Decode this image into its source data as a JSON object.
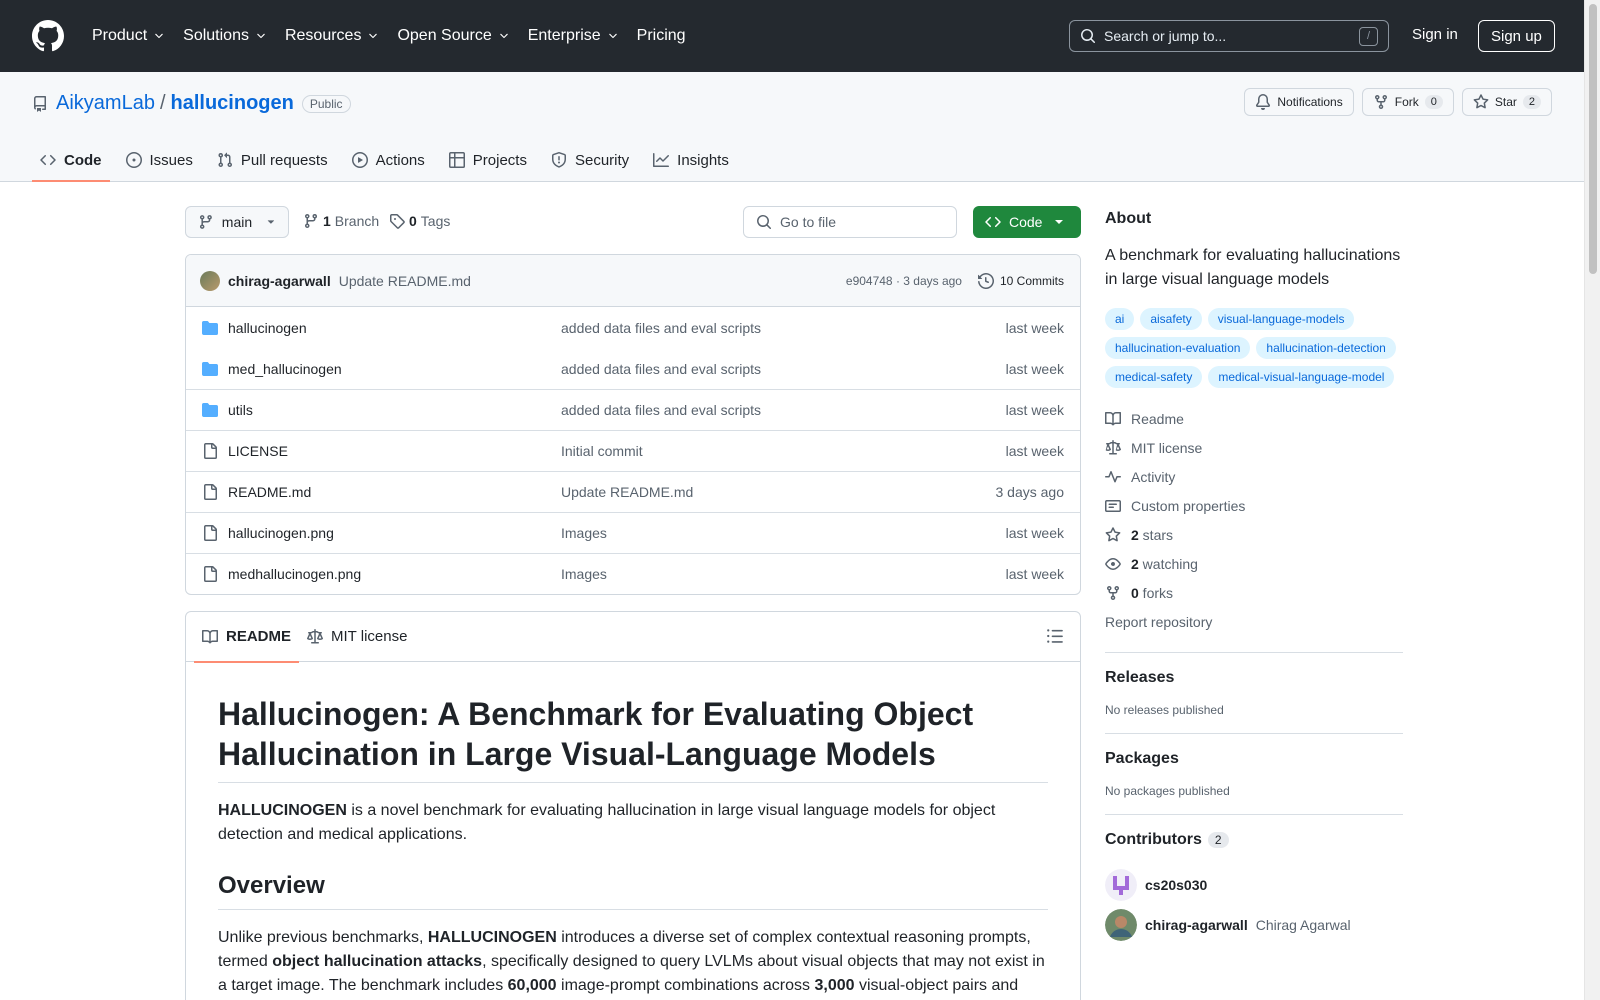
{
  "header": {
    "nav": [
      "Product",
      "Solutions",
      "Resources",
      "Open Source",
      "Enterprise",
      "Pricing"
    ],
    "search_placeholder": "Search or jump to...",
    "search_shortcut": "/",
    "signin": "Sign in",
    "signup": "Sign up"
  },
  "repo": {
    "owner": "AikyamLab",
    "separator": "/",
    "name": "hallucinogen",
    "visibility": "Public",
    "notifications": "Notifications",
    "fork_label": "Fork",
    "fork_count": "0",
    "star_label": "Star",
    "star_count": "2",
    "tabs": [
      "Code",
      "Issues",
      "Pull requests",
      "Actions",
      "Projects",
      "Security",
      "Insights"
    ]
  },
  "file_nav": {
    "branch": "main",
    "branch_count": "1",
    "branch_label": "Branch",
    "tag_count": "0",
    "tag_label": "Tags",
    "goto_placeholder": "Go to file",
    "code_button": "Code"
  },
  "latest_commit": {
    "author": "chirag-agarwall",
    "message": "Update README.md",
    "meta": "e904748 · 3 days ago",
    "commits": "10 Commits"
  },
  "files": [
    {
      "type": "dir",
      "name": "hallucinogen",
      "message": "added data files and eval scripts",
      "time": "last week"
    },
    {
      "type": "dir",
      "name": "med_hallucinogen",
      "message": "added data files and eval scripts",
      "time": "last week"
    },
    {
      "type": "dir",
      "name": "utils",
      "message": "added data files and eval scripts",
      "time": "last week"
    },
    {
      "type": "file",
      "name": "LICENSE",
      "message": "Initial commit",
      "time": "last week"
    },
    {
      "type": "file",
      "name": "README.md",
      "message": "Update README.md",
      "time": "3 days ago"
    },
    {
      "type": "file",
      "name": "hallucinogen.png",
      "message": "Images",
      "time": "last week"
    },
    {
      "type": "file",
      "name": "medhallucinogen.png",
      "message": "Images",
      "time": "last week"
    }
  ],
  "readme": {
    "tabs": [
      "README",
      "MIT license"
    ],
    "title": "Hallucinogen: A Benchmark for Evaluating Object Hallucination in Large Visual-Language Models",
    "intro_bold": "HALLUCINOGEN",
    "intro_rest": " is a novel benchmark for evaluating hallucination in large visual language models for object detection and medical applications.",
    "overview_heading": "Overview",
    "overview_parts": [
      {
        "t": "Unlike previous benchmarks, ",
        "b": false
      },
      {
        "t": "HALLUCINOGEN",
        "b": true
      },
      {
        "t": " introduces a diverse set of complex contextual reasoning prompts, termed ",
        "b": false
      },
      {
        "t": "object hallucination attacks",
        "b": true
      },
      {
        "t": ", specifically designed to query LVLMs about visual objects that may not exist in a target image. The benchmark includes ",
        "b": false
      },
      {
        "t": "60,000",
        "b": true
      },
      {
        "t": " image-prompt combinations across ",
        "b": false
      },
      {
        "t": "3,000",
        "b": true
      },
      {
        "t": " visual-object pairs and",
        "b": false
      }
    ]
  },
  "about": {
    "heading": "About",
    "description": "A benchmark for evaluating hallucinations in large visual language models",
    "topics": [
      "ai",
      "aisafety",
      "visual-language-models",
      "hallucination-evaluation",
      "hallucination-detection",
      "medical-safety",
      "medical-visual-language-model"
    ],
    "links": [
      {
        "icon": "book-icon",
        "bold": "",
        "text": "Readme"
      },
      {
        "icon": "law-icon",
        "bold": "",
        "text": "MIT license"
      },
      {
        "icon": "pulse-icon",
        "bold": "",
        "text": "Activity"
      },
      {
        "icon": "note-icon",
        "bold": "",
        "text": "Custom properties"
      },
      {
        "icon": "star-icon",
        "bold": "2",
        "text": " stars"
      },
      {
        "icon": "eye-icon",
        "bold": "2",
        "text": " watching"
      },
      {
        "icon": "fork-icon",
        "bold": "0",
        "text": " forks"
      }
    ],
    "report": "Report repository"
  },
  "releases": {
    "heading": "Releases",
    "empty": "No releases published"
  },
  "packages": {
    "heading": "Packages",
    "empty": "No packages published"
  },
  "contributors": {
    "heading": "Contributors",
    "count": "2",
    "list": [
      {
        "login": "cs20s030",
        "name": ""
      },
      {
        "login": "chirag-agarwall",
        "name": "Chirag Agarwal"
      }
    ]
  }
}
